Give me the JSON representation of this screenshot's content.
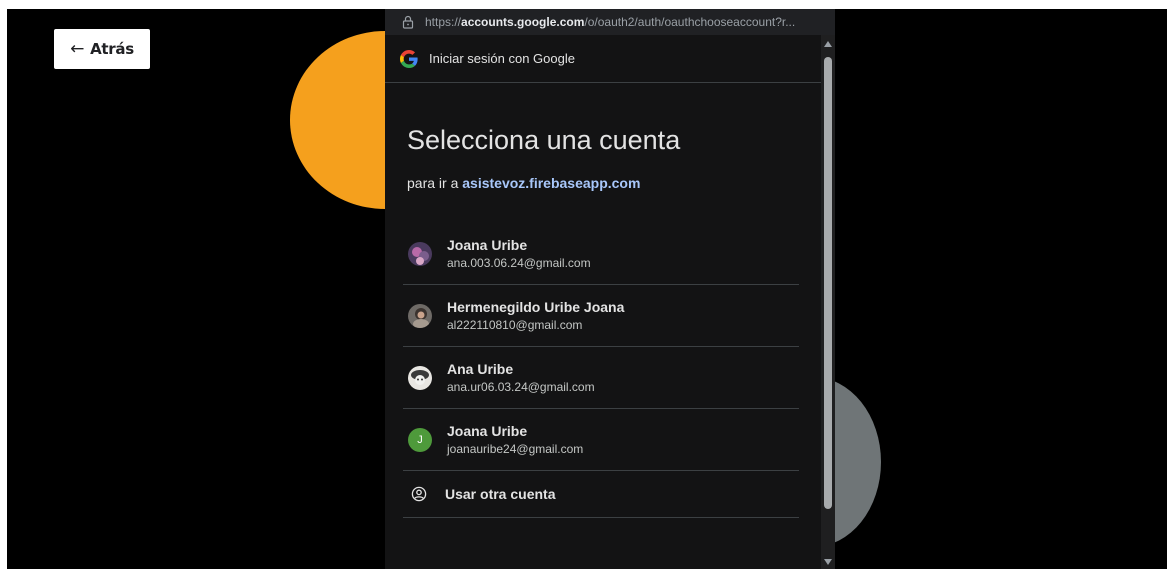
{
  "back_button": {
    "arrow": "←",
    "label": "Atrás"
  },
  "browser": {
    "url_host": "accounts.google.com",
    "url_prefix": "https://",
    "url_path": "/o/oauth2/auth/oauthchooseaccount?r..."
  },
  "header": {
    "title": "Iniciar sesión con Google"
  },
  "main": {
    "heading": "Selecciona una cuenta",
    "subheading_prefix": "para ir a ",
    "subheading_link": "asistevoz.firebaseapp.com"
  },
  "accounts": [
    {
      "name": "Joana Uribe",
      "email": "ana.003.06.24@gmail.com"
    },
    {
      "name": "Hermenegildo Uribe Joana",
      "email": "al222110810@gmail.com"
    },
    {
      "name": "Ana Uribe",
      "email": "ana.ur06.03.24@gmail.com"
    },
    {
      "name": "Joana Uribe",
      "email": "joanauribe24@gmail.com",
      "initial": "J"
    }
  ],
  "other_account": {
    "label": "Usar otra cuenta"
  },
  "colors": {
    "orange_circle": "#f5a01d",
    "gray_circle": "#6f7577",
    "link": "#a8c7fa",
    "popup_bg": "#131314"
  }
}
